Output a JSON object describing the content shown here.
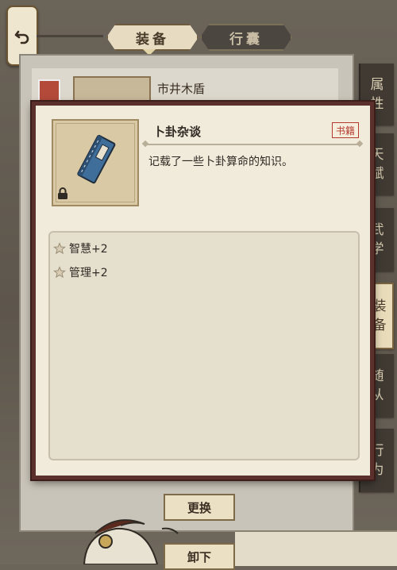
{
  "top_tabs": [
    {
      "label": "装备",
      "active": true
    },
    {
      "label": "行囊",
      "active": false
    }
  ],
  "background_item_name": "市井木盾",
  "side_tabs": [
    {
      "label": "属性",
      "active": false
    },
    {
      "label": "天赋",
      "active": false
    },
    {
      "label": "武学",
      "active": false
    },
    {
      "label": "装备",
      "active": true
    },
    {
      "label": "随从",
      "active": false
    },
    {
      "label": "行为",
      "active": false
    }
  ],
  "popup": {
    "item_name": "卜卦杂谈",
    "item_type": "书籍",
    "description": "记载了一些卜卦算命的知识。",
    "stats": [
      "智慧+2",
      "管理+2"
    ],
    "locked": true
  },
  "buttons": {
    "change": "更换",
    "unequip": "卸下"
  },
  "icons": {
    "back": "back-arrow-icon",
    "lock": "lock-icon",
    "item": "book-icon",
    "stat": "star-icon"
  }
}
